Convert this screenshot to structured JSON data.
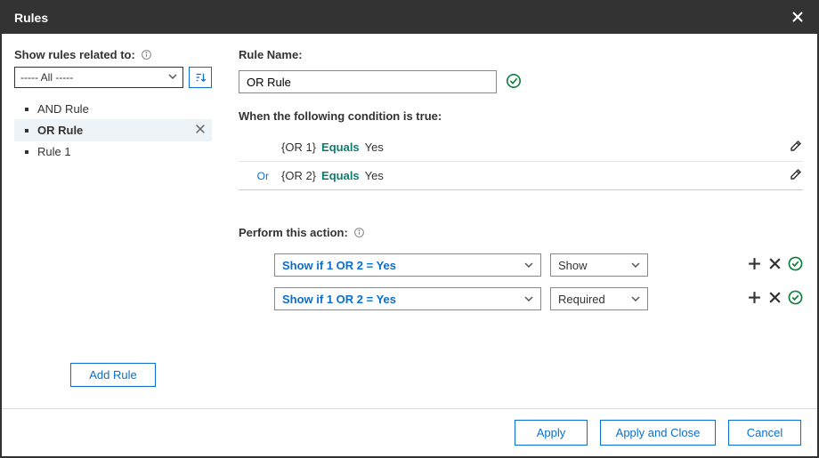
{
  "dialog": {
    "title": "Rules"
  },
  "left": {
    "filter_label": "Show rules related to:",
    "filter_value": "----- All -----",
    "rules": [
      {
        "label": "AND Rule",
        "selected": false
      },
      {
        "label": "OR Rule",
        "selected": true
      },
      {
        "label": "Rule 1",
        "selected": false
      }
    ],
    "add_rule": "Add Rule"
  },
  "right": {
    "rule_name_label": "Rule Name:",
    "rule_name_value": "OR Rule",
    "condition_header": "When the following condition is true:",
    "conditions": [
      {
        "conj": "",
        "field": "{OR 1}",
        "op": "Equals",
        "val": "Yes"
      },
      {
        "conj": "Or",
        "field": "{OR 2}",
        "op": "Equals",
        "val": "Yes"
      }
    ],
    "action_header": "Perform this action:",
    "actions": [
      {
        "target": "Show if 1 OR 2 = Yes",
        "op": "Show"
      },
      {
        "target": "Show if 1 OR 2 = Yes",
        "op": "Required"
      }
    ]
  },
  "footer": {
    "apply": "Apply",
    "apply_close": "Apply and Close",
    "cancel": "Cancel"
  }
}
